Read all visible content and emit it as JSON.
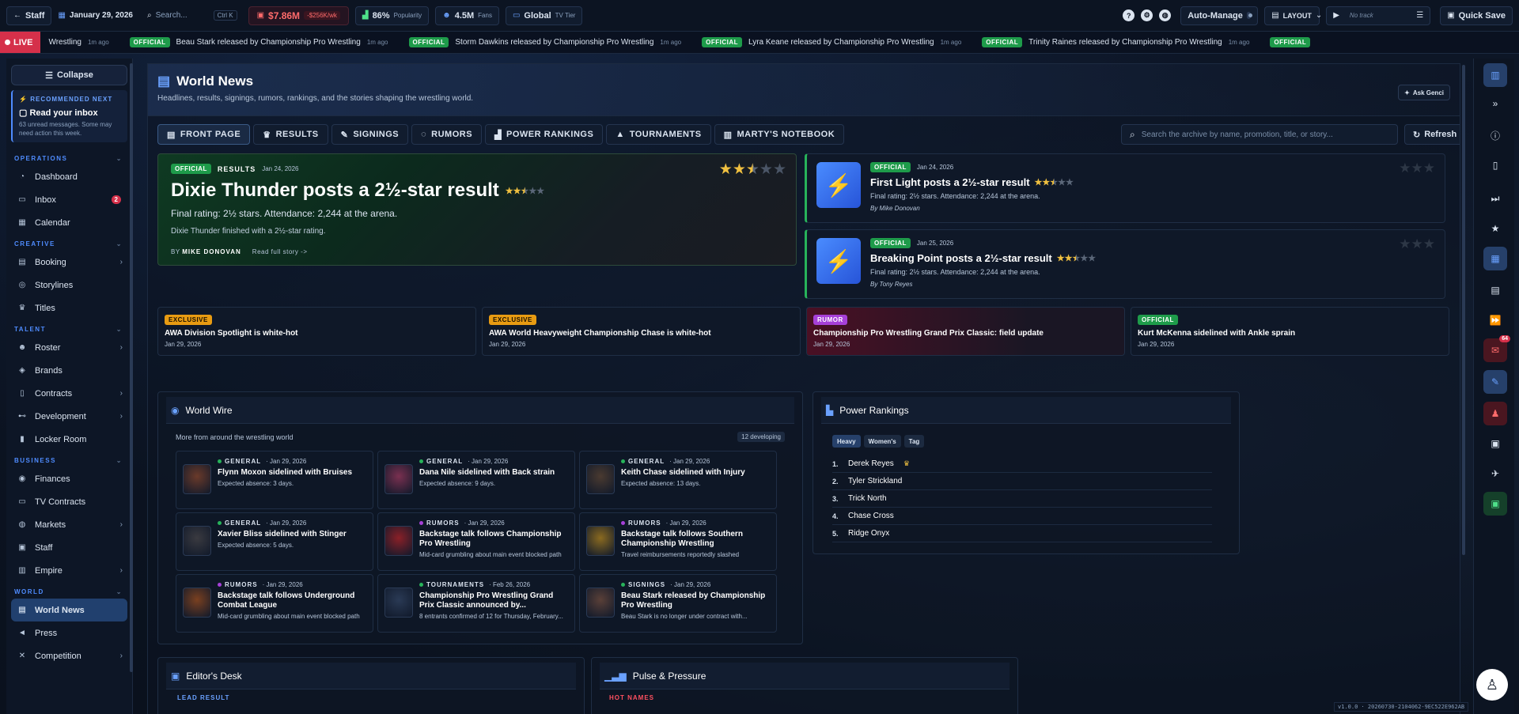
{
  "topbar": {
    "staff_label": "Staff",
    "date": "January 29, 2026",
    "search_placeholder": "Search...",
    "search_shortcut": "Ctrl K",
    "money": "$7.86M",
    "money_delta": "-$256K/wk",
    "popularity_value": "86%",
    "popularity_label": "Popularity",
    "fans_value": "4.5M",
    "fans_label": "Fans",
    "tier_value": "Global",
    "tier_label": "TV Tier",
    "auto_manage": "Auto-Manage",
    "layout": "LAYOUT",
    "track": "No track",
    "quick_save": "Quick Save"
  },
  "ticker": {
    "live_label": "LIVE",
    "items": [
      {
        "badge": "",
        "text": "Wrestling",
        "ago": "1m ago"
      },
      {
        "badge": "OFFICIAL",
        "text": "Beau Stark released by Championship Pro Wrestling",
        "ago": "1m ago"
      },
      {
        "badge": "OFFICIAL",
        "text": "Storm Dawkins released by Championship Pro Wrestling",
        "ago": "1m ago"
      },
      {
        "badge": "OFFICIAL",
        "text": "Lyra Keane released by Championship Pro Wrestling",
        "ago": "1m ago"
      },
      {
        "badge": "OFFICIAL",
        "text": "Trinity Raines released by Championship Pro Wrestling",
        "ago": "1m ago"
      },
      {
        "badge": "OFFICIAL",
        "text": "",
        "ago": ""
      }
    ]
  },
  "sidebar": {
    "collapse": "Collapse",
    "reco_header": "RECOMMENDED NEXT",
    "reco_title": "Read your inbox",
    "reco_desc": "63 unread messages. Some may need action this week.",
    "sections": [
      {
        "title": "OPERATIONS",
        "items": [
          {
            "label": "Dashboard",
            "icon": "gauge-icon"
          },
          {
            "label": "Inbox",
            "icon": "inbox-icon",
            "count": "2"
          },
          {
            "label": "Calendar",
            "icon": "calendar-icon"
          }
        ]
      },
      {
        "title": "CREATIVE",
        "items": [
          {
            "label": "Booking",
            "icon": "clipboard-icon",
            "chevron": true
          },
          {
            "label": "Storylines",
            "icon": "spiral-icon"
          },
          {
            "label": "Titles",
            "icon": "trophy-icon"
          }
        ]
      },
      {
        "title": "TALENT",
        "items": [
          {
            "label": "Roster",
            "icon": "users-icon",
            "chevron": true
          },
          {
            "label": "Brands",
            "icon": "tag-icon"
          },
          {
            "label": "Contracts",
            "icon": "document-icon",
            "chevron": true
          },
          {
            "label": "Development",
            "icon": "dumbbell-icon",
            "chevron": true
          },
          {
            "label": "Locker Room",
            "icon": "locker-icon"
          }
        ]
      },
      {
        "title": "BUSINESS",
        "items": [
          {
            "label": "Finances",
            "icon": "coins-icon"
          },
          {
            "label": "TV Contracts",
            "icon": "tv-icon"
          },
          {
            "label": "Markets",
            "icon": "globe-icon",
            "chevron": true
          },
          {
            "label": "Staff",
            "icon": "id-badge-icon"
          },
          {
            "label": "Empire",
            "icon": "building-icon",
            "chevron": true
          }
        ]
      },
      {
        "title": "WORLD",
        "items": [
          {
            "label": "World News",
            "icon": "newspaper-icon",
            "active": true
          },
          {
            "label": "Press",
            "icon": "megaphone-icon"
          },
          {
            "label": "Competition",
            "icon": "swords-icon",
            "chevron": true
          }
        ]
      }
    ]
  },
  "page": {
    "title": "World News",
    "subtitle": "Headlines, results, signings, rumors, rankings, and the stories shaping the wrestling world.",
    "ask_label": "Ask Genci",
    "tabs": [
      "FRONT PAGE",
      "RESULTS",
      "SIGNINGS",
      "RUMORS",
      "POWER RANKINGS",
      "TOURNAMENTS",
      "MARTY'S NOTEBOOK"
    ],
    "search_placeholder": "Search the archive by name, promotion, title, or story...",
    "refresh": "Refresh"
  },
  "feature": {
    "badge": "OFFICIAL",
    "category": "RESULTS",
    "date": "Jan 24, 2026",
    "title": "Dixie Thunder posts a 2½-star result",
    "rating": 2.5,
    "line1": "Final rating: 2½ stars. Attendance: 2,244 at the arena.",
    "line2": "Dixie Thunder finished with a 2½-star rating.",
    "by_label": "BY",
    "author": "MIKE DONOVAN",
    "read_more": "Read full story ->"
  },
  "side_stories": [
    {
      "badge": "OFFICIAL",
      "date": "Jan 24, 2026",
      "title": "First Light posts a 2½-star result",
      "rating": 2.5,
      "line": "Final rating: 2½ stars. Attendance: 2,244 at the arena.",
      "by": "By Mike Donovan"
    },
    {
      "badge": "OFFICIAL",
      "date": "Jan 25, 2026",
      "title": "Breaking Point posts a 2½-star result",
      "rating": 2.5,
      "line": "Final rating: 2½ stars. Attendance: 2,244 at the arena.",
      "by": "By Tony Reyes"
    }
  ],
  "mini_stories": [
    {
      "badge": "EXCLUSIVE",
      "title": "AWA Division Spotlight is white-hot",
      "date": "Jan 29, 2026"
    },
    {
      "badge": "EXCLUSIVE",
      "title": "AWA World Heavyweight Championship Chase is white-hot",
      "date": "Jan 29, 2026"
    },
    {
      "badge": "RUMOR",
      "title": "Championship Pro Wrestling Grand Prix Classic: field update",
      "date": "Jan 29, 2026"
    },
    {
      "badge": "OFFICIAL",
      "title": "Kurt McKenna sidelined with Ankle sprain",
      "date": "Jan 29, 2026"
    }
  ],
  "world_wire": {
    "title": "World Wire",
    "subtitle": "More from around the wrestling world",
    "developing": "12 developing",
    "items": [
      {
        "cat": "GENERAL",
        "color": "#27b35a",
        "date": "Jan 29, 2026",
        "title": "Flynn Moxon sidelined with Bruises",
        "desc": "Expected absence: 3 days.",
        "thumb": "#6a3a2a"
      },
      {
        "cat": "GENERAL",
        "color": "#27b35a",
        "date": "Jan 29, 2026",
        "title": "Dana Nile sidelined with Back strain",
        "desc": "Expected absence: 9 days.",
        "thumb": "#7a3050"
      },
      {
        "cat": "GENERAL",
        "color": "#27b35a",
        "date": "Jan 29, 2026",
        "title": "Keith Chase sidelined with Injury",
        "desc": "Expected absence: 13 days.",
        "thumb": "#4a3a30"
      },
      {
        "cat": "GENERAL",
        "color": "#27b35a",
        "date": "Jan 29, 2026",
        "title": "Xavier Bliss sidelined with Stinger",
        "desc": "Expected absence: 5 days.",
        "thumb": "#3a3a40"
      },
      {
        "cat": "RUMORS",
        "color": "#a640d8",
        "date": "Jan 29, 2026",
        "title": "Backstage talk follows Championship Pro Wrestling",
        "desc": "Mid-card grumbling about main event blocked path",
        "thumb": "#8a2028"
      },
      {
        "cat": "RUMORS",
        "color": "#a640d8",
        "date": "Jan 29, 2026",
        "title": "Backstage talk follows Southern Championship Wrestling",
        "desc": "Travel reimbursements reportedly slashed",
        "thumb": "#8a6a20"
      },
      {
        "cat": "RUMORS",
        "color": "#a640d8",
        "date": "Jan 29, 2026",
        "title": "Backstage talk follows Underground Combat League",
        "desc": "Mid-card grumbling about main event blocked path",
        "thumb": "#7a4020"
      },
      {
        "cat": "TOURNAMENTS",
        "color": "#27b35a",
        "date": "Feb 26, 2026",
        "title": "Championship Pro Wrestling Grand Prix Classic announced by...",
        "desc": "8 entrants confirmed of 12 for Thursday, February...",
        "thumb": "#2a3a55"
      },
      {
        "cat": "SIGNINGS",
        "color": "#27b35a",
        "date": "Jan 29, 2026",
        "title": "Beau Stark released by Championship Pro Wrestling",
        "desc": "Beau Stark is no longer under contract with...",
        "thumb": "#5a4038"
      }
    ]
  },
  "power_rankings": {
    "title": "Power Rankings",
    "tabs": [
      "Heavy",
      "Women's",
      "Tag"
    ],
    "entries": [
      "Derek Reyes",
      "Tyler Strickland",
      "Trick North",
      "Chase Cross",
      "Ridge Onyx"
    ]
  },
  "editors_desk": {
    "title": "Editor's Desk",
    "lead": "LEAD RESULT"
  },
  "pulse": {
    "title": "Pulse & Pressure",
    "hot": "HOT NAMES"
  },
  "rail": {
    "badge": "64"
  },
  "version": "v1.0.0 · 20260730-2104062-9EC522E962AB"
}
